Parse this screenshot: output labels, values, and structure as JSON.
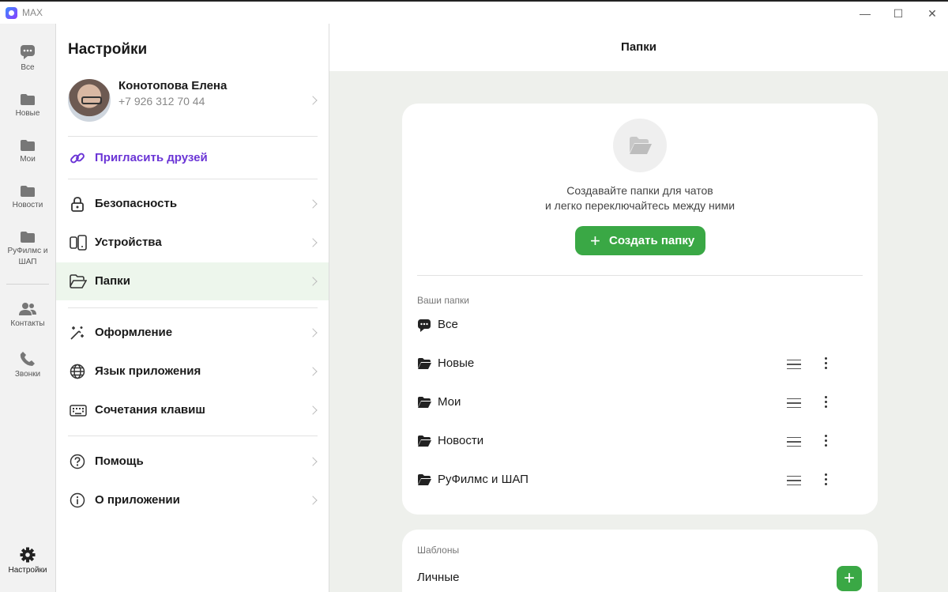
{
  "window": {
    "title": "MAX",
    "controls": [
      "—",
      "☐",
      "✕"
    ]
  },
  "rail": {
    "items": [
      {
        "label": "Все",
        "icon": "chat-bubble-icon"
      },
      {
        "label": "Новые",
        "icon": "folder-icon"
      },
      {
        "label": "Мои",
        "icon": "folder-icon"
      },
      {
        "label": "Новости",
        "icon": "folder-icon"
      },
      {
        "label": "РуФилмс и ШАП",
        "icon": "folder-icon"
      },
      {
        "label": "Контакты",
        "icon": "people-icon"
      },
      {
        "label": "Звонки",
        "icon": "phone-icon"
      }
    ],
    "settings_label": "Настройки"
  },
  "settings": {
    "title": "Настройки",
    "profile": {
      "name": "Конотопова Елена",
      "phone": "+7 926 312 70 44"
    },
    "invite": "Пригласить друзей",
    "items": [
      {
        "label": "Безопасность",
        "icon": "lock-icon"
      },
      {
        "label": "Устройства",
        "icon": "devices-icon"
      },
      {
        "label": "Папки",
        "icon": "folder-open-icon"
      },
      {
        "label": "Оформление",
        "icon": "magic-wand-icon"
      },
      {
        "label": "Язык приложения",
        "icon": "globe-icon"
      },
      {
        "label": "Сочетания клавиш",
        "icon": "keyboard-icon"
      },
      {
        "label": "Помощь",
        "icon": "help-icon"
      },
      {
        "label": "О приложении",
        "icon": "info-icon"
      }
    ]
  },
  "main": {
    "title": "Папки",
    "hint_line1": "Создавайте папки для чатов",
    "hint_line2": "и легко переключайтесь между ними",
    "create_button": "Создать папку",
    "your_folders_title": "Ваши папки",
    "folders": [
      {
        "label": "Все",
        "icon": "chat-bubble-icon"
      },
      {
        "label": "Новые",
        "icon": "folder-icon"
      },
      {
        "label": "Мои",
        "icon": "folder-icon"
      },
      {
        "label": "Новости",
        "icon": "folder-icon"
      },
      {
        "label": "РуФилмс и ШАП",
        "icon": "folder-icon"
      }
    ],
    "templates_title": "Шаблоны",
    "templates": [
      {
        "label": "Личные"
      }
    ]
  },
  "colors": {
    "accent": "#3aa845",
    "invite": "#6b35d6",
    "active_row": "#edf6ec",
    "main_bg": "#eef0ec"
  }
}
